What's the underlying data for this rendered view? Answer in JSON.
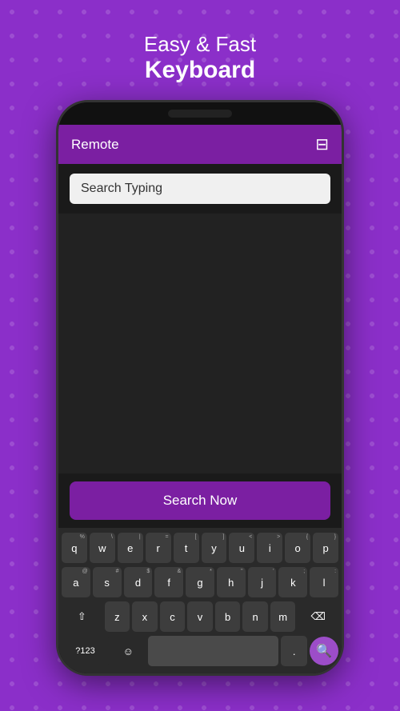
{
  "header": {
    "line1": "Easy & Fast",
    "line2": "Keyboard"
  },
  "app": {
    "toolbar_title": "Remote",
    "cast_icon": "⊡",
    "search_placeholder": "Search Typing",
    "search_button_label": "Search Now"
  },
  "keyboard": {
    "row1": [
      {
        "label": "q",
        "secondary": "%"
      },
      {
        "label": "w",
        "secondary": "\\"
      },
      {
        "label": "e",
        "secondary": "|"
      },
      {
        "label": "r",
        "secondary": "="
      },
      {
        "label": "t",
        "secondary": "["
      },
      {
        "label": "y",
        "secondary": "]"
      },
      {
        "label": "u",
        "secondary": "<"
      },
      {
        "label": "i",
        "secondary": ">"
      },
      {
        "label": "o",
        "secondary": "{"
      },
      {
        "label": "p",
        "secondary": "}"
      }
    ],
    "row2": [
      {
        "label": "a",
        "secondary": "@"
      },
      {
        "label": "s",
        "secondary": "#"
      },
      {
        "label": "d",
        "secondary": "$"
      },
      {
        "label": "f",
        "secondary": "&"
      },
      {
        "label": "g",
        "secondary": "*"
      },
      {
        "label": "h",
        "secondary": "\""
      },
      {
        "label": "j",
        "secondary": "'"
      },
      {
        "label": "k",
        "secondary": ";"
      },
      {
        "label": "l",
        "secondary": ":"
      }
    ],
    "row3": [
      {
        "label": "z",
        "secondary": ""
      },
      {
        "label": "x",
        "secondary": ""
      },
      {
        "label": "c",
        "secondary": ""
      },
      {
        "label": "v",
        "secondary": ""
      },
      {
        "label": "b",
        "secondary": ""
      },
      {
        "label": "n",
        "secondary": ""
      },
      {
        "label": "m",
        "secondary": ""
      }
    ],
    "num_label": "?123",
    "period_label": ".",
    "space_label": ""
  }
}
